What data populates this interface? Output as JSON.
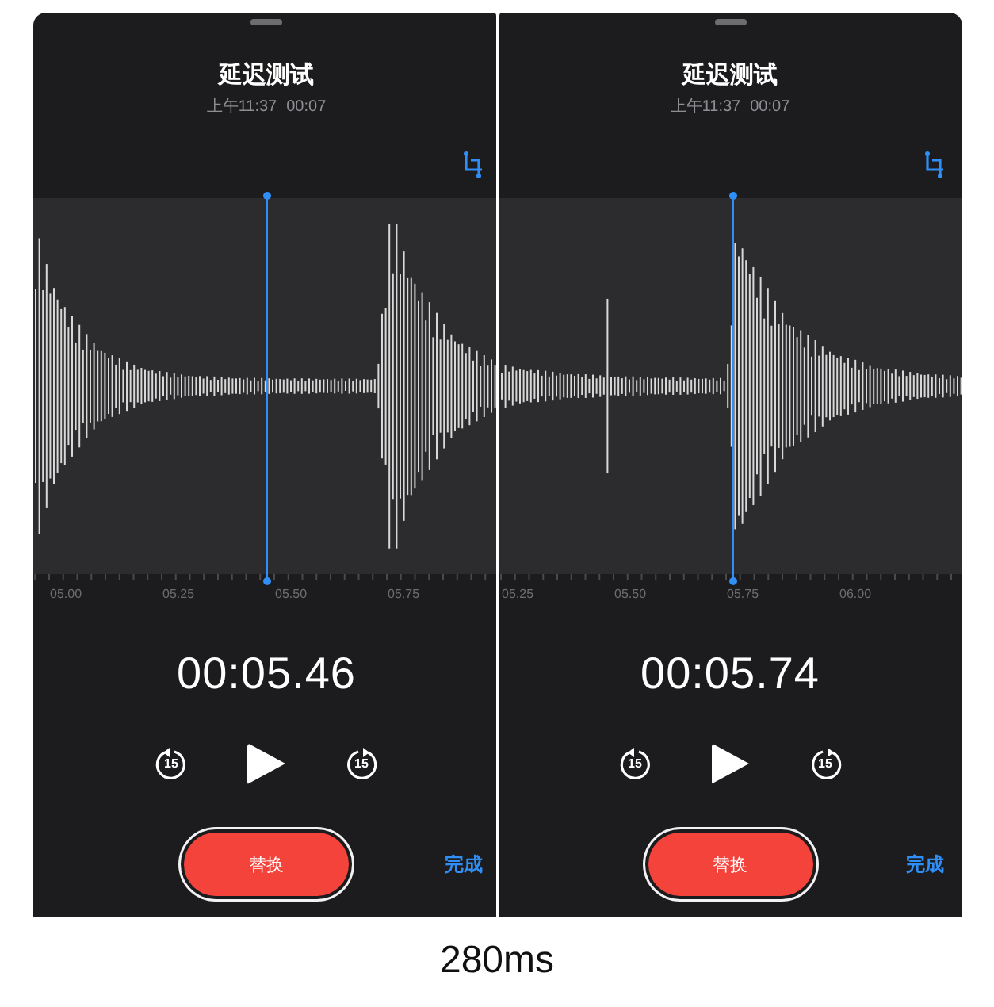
{
  "panels": [
    {
      "title": "延迟测试",
      "date": "上午11:37",
      "duration": "00:07",
      "timeline_labels": [
        "05.00",
        "05.25",
        "05.50",
        "05.75"
      ],
      "current_time": "00:05.46",
      "skip_back": "15",
      "skip_forward": "15",
      "replace_button": "替换",
      "done_button": "完成"
    },
    {
      "title": "延迟测试",
      "date": "上午11:37",
      "duration": "00:07",
      "timeline_labels": [
        "05.25",
        "05.50",
        "05.75",
        "06.00"
      ],
      "current_time": "00:05.74",
      "skip_back": "15",
      "skip_forward": "15",
      "replace_button": "替换",
      "done_button": "完成"
    }
  ],
  "caption": "280ms"
}
